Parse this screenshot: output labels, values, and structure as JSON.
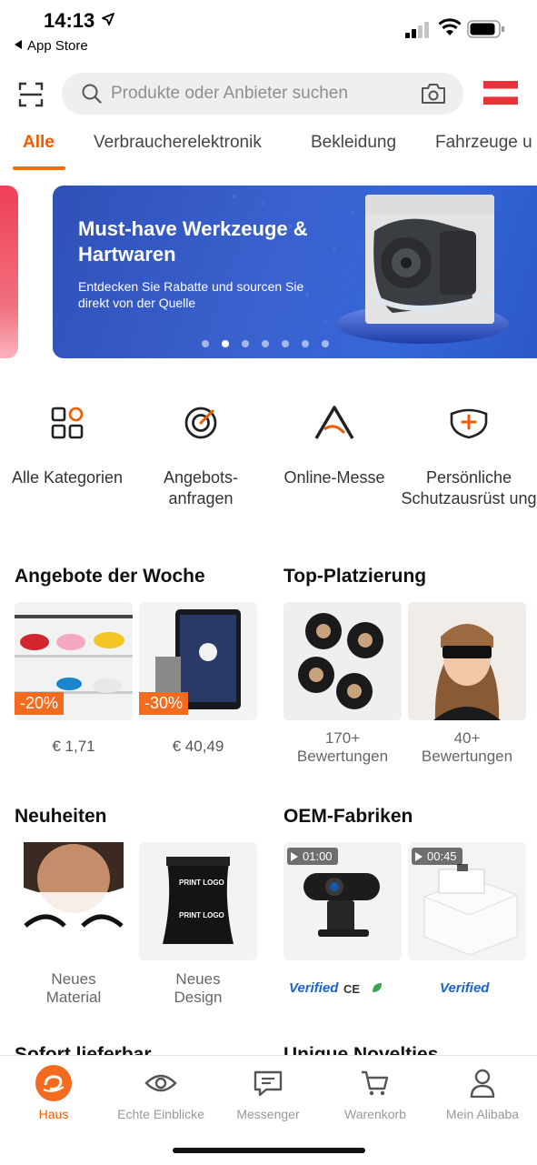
{
  "status": {
    "time": "14:13",
    "back_app": "App Store"
  },
  "search": {
    "placeholder": "Produkte oder Anbieter suchen"
  },
  "tabs": [
    {
      "label": "Alle",
      "active": true
    },
    {
      "label": "Verbraucherelektronik"
    },
    {
      "label": "Bekleidung"
    },
    {
      "label": "Fahrzeuge u"
    }
  ],
  "banner": {
    "title": "Must-have Werkzeuge & Hartwaren",
    "subtitle": "Entdecken Sie Rabatte und sourcen Sie direkt von der Quelle",
    "dots_total": 7,
    "active_dot": 2
  },
  "quick_links": [
    {
      "icon": "grid-icon",
      "label": "Alle Kategorien"
    },
    {
      "icon": "target-icon",
      "label": "Angebots-\nanfragen"
    },
    {
      "icon": "a-logo-icon",
      "label": "Online-Messe"
    },
    {
      "icon": "shield-plus-icon",
      "label": "Persönliche Schutzausrüst ung"
    }
  ],
  "sections": {
    "deals": {
      "title": "Angebote der Woche",
      "items": [
        {
          "discount": "-20%",
          "price": "€ 1,71"
        },
        {
          "discount": "-30%",
          "price": "€ 40,49"
        }
      ]
    },
    "top": {
      "title": "Top-Platzierung",
      "items": [
        {
          "caption": "170+\nBewertungen"
        },
        {
          "caption": "40+\nBewertungen"
        }
      ]
    },
    "new": {
      "title": "Neuheiten",
      "items": [
        {
          "caption": "Neues\nMaterial",
          "print_text": ""
        },
        {
          "caption": "Neues\nDesign",
          "print_text": "PRINT LOGO"
        }
      ]
    },
    "oem": {
      "title": "OEM-Fabriken",
      "items": [
        {
          "duration": "01:00",
          "badge": "Verified",
          "cert": "CE"
        },
        {
          "duration": "00:45",
          "badge": "Verified"
        }
      ]
    },
    "peek": {
      "left": "Sofort lieferbar",
      "right": "Unique Novelties"
    }
  },
  "nav": [
    {
      "label": "Haus",
      "active": true
    },
    {
      "label": "Echte Einblicke"
    },
    {
      "label": "Messenger"
    },
    {
      "label": "Warenkorb"
    },
    {
      "label": "Mein Alibaba"
    }
  ],
  "colors": {
    "accent": "#F05A00",
    "banner": "#3A62CF",
    "verified": "#1B61D1"
  }
}
